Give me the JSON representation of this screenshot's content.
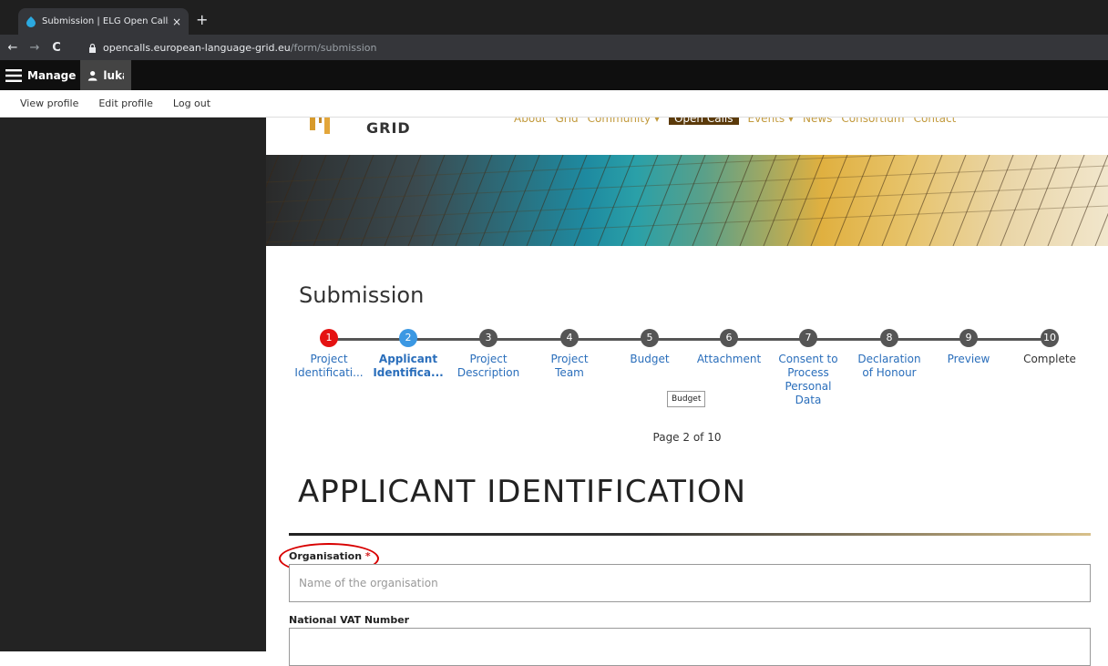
{
  "browser": {
    "tab_title": "Submission | ELG Open Calls Platf",
    "tab_close": "×",
    "new_tab": "+",
    "nav_back": "←",
    "nav_forward": "→",
    "nav_reload": "C",
    "url_host": "opencalls.european-language-grid.eu",
    "url_path": "/form/submission"
  },
  "toolbar": {
    "manage_label": "Manage",
    "user_label": "lukas",
    "tray": [
      "View profile",
      "Edit profile",
      "Log out"
    ]
  },
  "site": {
    "logo_text": "GRID",
    "nav": [
      "About",
      "Grid",
      "Community ▾",
      "Open Calls",
      "Events ▾",
      "News",
      "Consortium",
      "Contact"
    ]
  },
  "page": {
    "subtitle": "Submission",
    "steps": [
      {
        "num": "1",
        "label_line1": "Project",
        "label_line2": "Identificati...",
        "state": "error"
      },
      {
        "num": "2",
        "label_line1": "Applicant",
        "label_line2": "Identifica...",
        "state": "current"
      },
      {
        "num": "3",
        "label_line1": "Project",
        "label_line2": "Description",
        "state": "default"
      },
      {
        "num": "4",
        "label_line1": "Project",
        "label_line2": "Team",
        "state": "default"
      },
      {
        "num": "5",
        "label_line1": "Budget",
        "label_line2": "",
        "state": "default"
      },
      {
        "num": "6",
        "label_line1": "Attachment",
        "label_line2": "",
        "state": "default"
      },
      {
        "num": "7",
        "label_line1": "Consent to",
        "label_line2": "Process",
        "label_line3": "Personal",
        "label_line4": "Data",
        "state": "default"
      },
      {
        "num": "8",
        "label_line1": "Declaration",
        "label_line2": "of Honour",
        "state": "default"
      },
      {
        "num": "9",
        "label_line1": "Preview",
        "label_line2": "",
        "state": "default"
      },
      {
        "num": "10",
        "label_line1": "Complete",
        "label_line2": "",
        "state": "complete"
      }
    ],
    "tooltip": "Budget",
    "page_count": "Page 2 of 10",
    "section_title": "APPLICANT IDENTIFICATION",
    "fields": {
      "organisation_label": "Organisation",
      "organisation_required": "*",
      "organisation_placeholder": "Name of the organisation",
      "vat_label": "National VAT Number",
      "vat_placeholder": ""
    }
  },
  "colors": {
    "error_step": "#e51212",
    "current_step": "#3b98e3",
    "link_blue": "#2a6ebb",
    "annotation_red": "#d80000"
  }
}
